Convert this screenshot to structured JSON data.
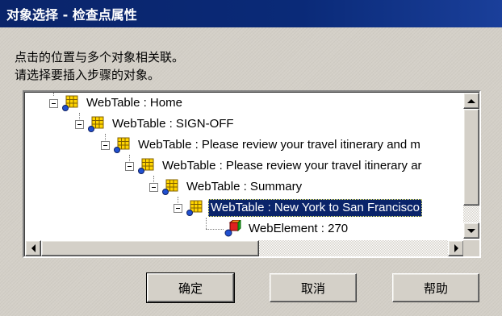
{
  "window": {
    "title": "对象选择 - 检查点属性"
  },
  "message": {
    "line1": "点击的位置与多个对象相关联。",
    "line2": "请选择要插入步骤的对象。"
  },
  "tree": {
    "nodes": [
      {
        "label": "WebTable : Home",
        "icon": "webtable-icon",
        "expanded": true,
        "selected": false
      },
      {
        "label": "WebTable : SIGN-OFF",
        "icon": "webtable-icon",
        "expanded": true,
        "selected": false
      },
      {
        "label": "WebTable : Please review your travel itinerary and m",
        "icon": "webtable-icon",
        "expanded": true,
        "selected": false
      },
      {
        "label": "WebTable : Please review your travel itinerary ar",
        "icon": "webtable-icon",
        "expanded": true,
        "selected": false
      },
      {
        "label": "WebTable : Summary",
        "icon": "webtable-icon",
        "expanded": true,
        "selected": false
      },
      {
        "label": "WebTable : New York to San Francisco",
        "icon": "webtable-icon",
        "expanded": true,
        "selected": true
      },
      {
        "label": "WebElement : 270",
        "icon": "webelement-icon",
        "expanded": false,
        "selected": false
      }
    ]
  },
  "buttons": {
    "ok": "确定",
    "cancel": "取消",
    "help": "帮助"
  },
  "colors": {
    "titlebar": "#0a246a",
    "selection": "#0a246a",
    "face": "#d4d0c8"
  }
}
